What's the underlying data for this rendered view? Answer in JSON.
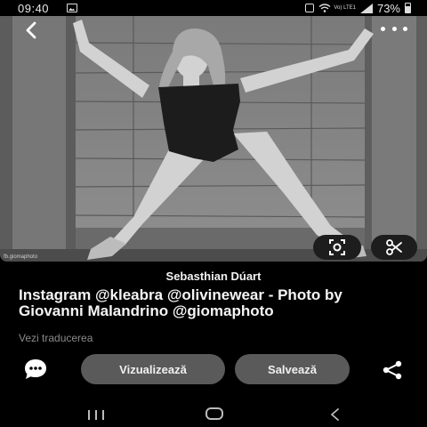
{
  "status_bar": {
    "time": "09:40",
    "network_label": "Vo) LTE1",
    "battery": "73%"
  },
  "pin": {
    "photo_watermark": "fb.giomaphoto",
    "author": "Sebasthian Dúart",
    "caption": "Instagram @kleabra @olivinewear - Photo by Giovanni Malandrino @giomaphoto",
    "translate_label": "Vezi traducerea"
  },
  "actions": {
    "view_label": "Vizualizează",
    "save_label": "Salvează"
  },
  "icons": {
    "back": "chevron-left-icon",
    "more": "more-dots-icon",
    "lens": "visual-search-icon",
    "scissors": "scissors-icon",
    "comment": "comment-bubble-icon",
    "share": "share-icon"
  },
  "colors": {
    "background": "#000000",
    "button": "#5a5a5a",
    "muted_text": "#8b8b8b"
  }
}
